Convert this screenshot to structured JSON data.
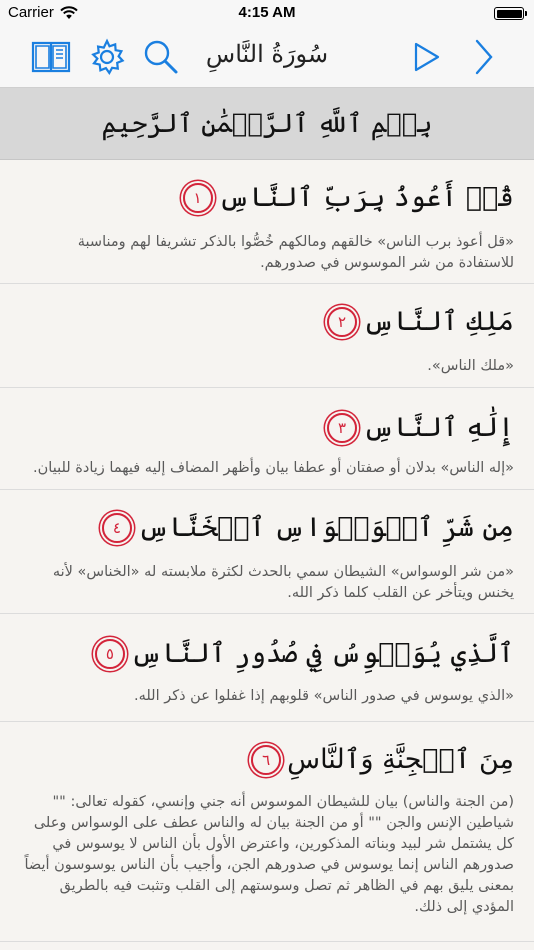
{
  "status": {
    "carrier": "Carrier",
    "time": "4:15 AM"
  },
  "nav": {
    "title": "سُورَةُ النَّاسِ"
  },
  "basmala": "بِسۡمِ ٱللَّهِ ٱلرَّحۡمَٰنِ ٱلرَّحِيمِ",
  "colors": {
    "accent": "#1a7fe0",
    "ayah_marker": "#d3243a",
    "basmala_bg": "#d7d7d7"
  },
  "icons": [
    "book-icon",
    "gear-icon",
    "search-icon",
    "play-icon",
    "chevron-right-icon"
  ],
  "verses": [
    {
      "number": "١",
      "text": "قُلۡ أَعُوذُ بِرَبِّ ٱلنَّاسِ",
      "tafsir": "«قل أعوذ برب الناس» خالقهم ومالكهم خُصُّوا بالذكر تشريفا لهم ومناسبة للاستفادة من شر الموسوس في صدورهم."
    },
    {
      "number": "٢",
      "text": "مَلِكِ ٱلنَّاسِ",
      "tafsir": "«ملك الناس»."
    },
    {
      "number": "٣",
      "text": "إِلَٰهِ ٱلنَّاسِ",
      "tafsir": "«إله الناس» بدلان أو صفتان أو عطفا بيان وأظهر المضاف إليه فيهما زيادة للبيان."
    },
    {
      "number": "٤",
      "text": "مِن شَرِّ ٱلۡوَسۡوَاسِ ٱلۡخَنَّاسِ",
      "tafsir": "«من شر الوسواس» الشيطان سمي بالحدث لكثرة ملابسته له «الخناس» لأنه يخنس ويتأخر عن القلب كلما ذكر الله."
    },
    {
      "number": "٥",
      "text": "ٱلَّذِي يُوَسۡوِسُ فِي صُدُورِ ٱلنَّاسِ",
      "tafsir": "«الذي يوسوس في صدور الناس» قلوبهم إذا غفلوا عن ذكر الله."
    },
    {
      "number": "٦",
      "text": "مِنَ ٱلۡجِنَّةِ وَٱلنَّاسِ",
      "tafsir": "(من الجنة والناس) بيان للشيطان الموسوس أنه جني وإنسي، كقوله تعالى: \"\" شياطين الإنس والجن \"\" أو من الجنة بيان له والناس عطف على الوسواس وعلى كل يشتمل شر لبيد وبناته المذكورين، واعترض الأول بأن الناس لا يوسوس في صدورهم الناس إنما يوسوس في صدورهم الجن، وأجيب بأن الناس يوسوسون أيضاً بمعنى يليق بهم في الظاهر ثم تصل وسوستهم إلى القلب وتثبت فيه بالطريق المؤدي إلى ذلك."
    }
  ]
}
